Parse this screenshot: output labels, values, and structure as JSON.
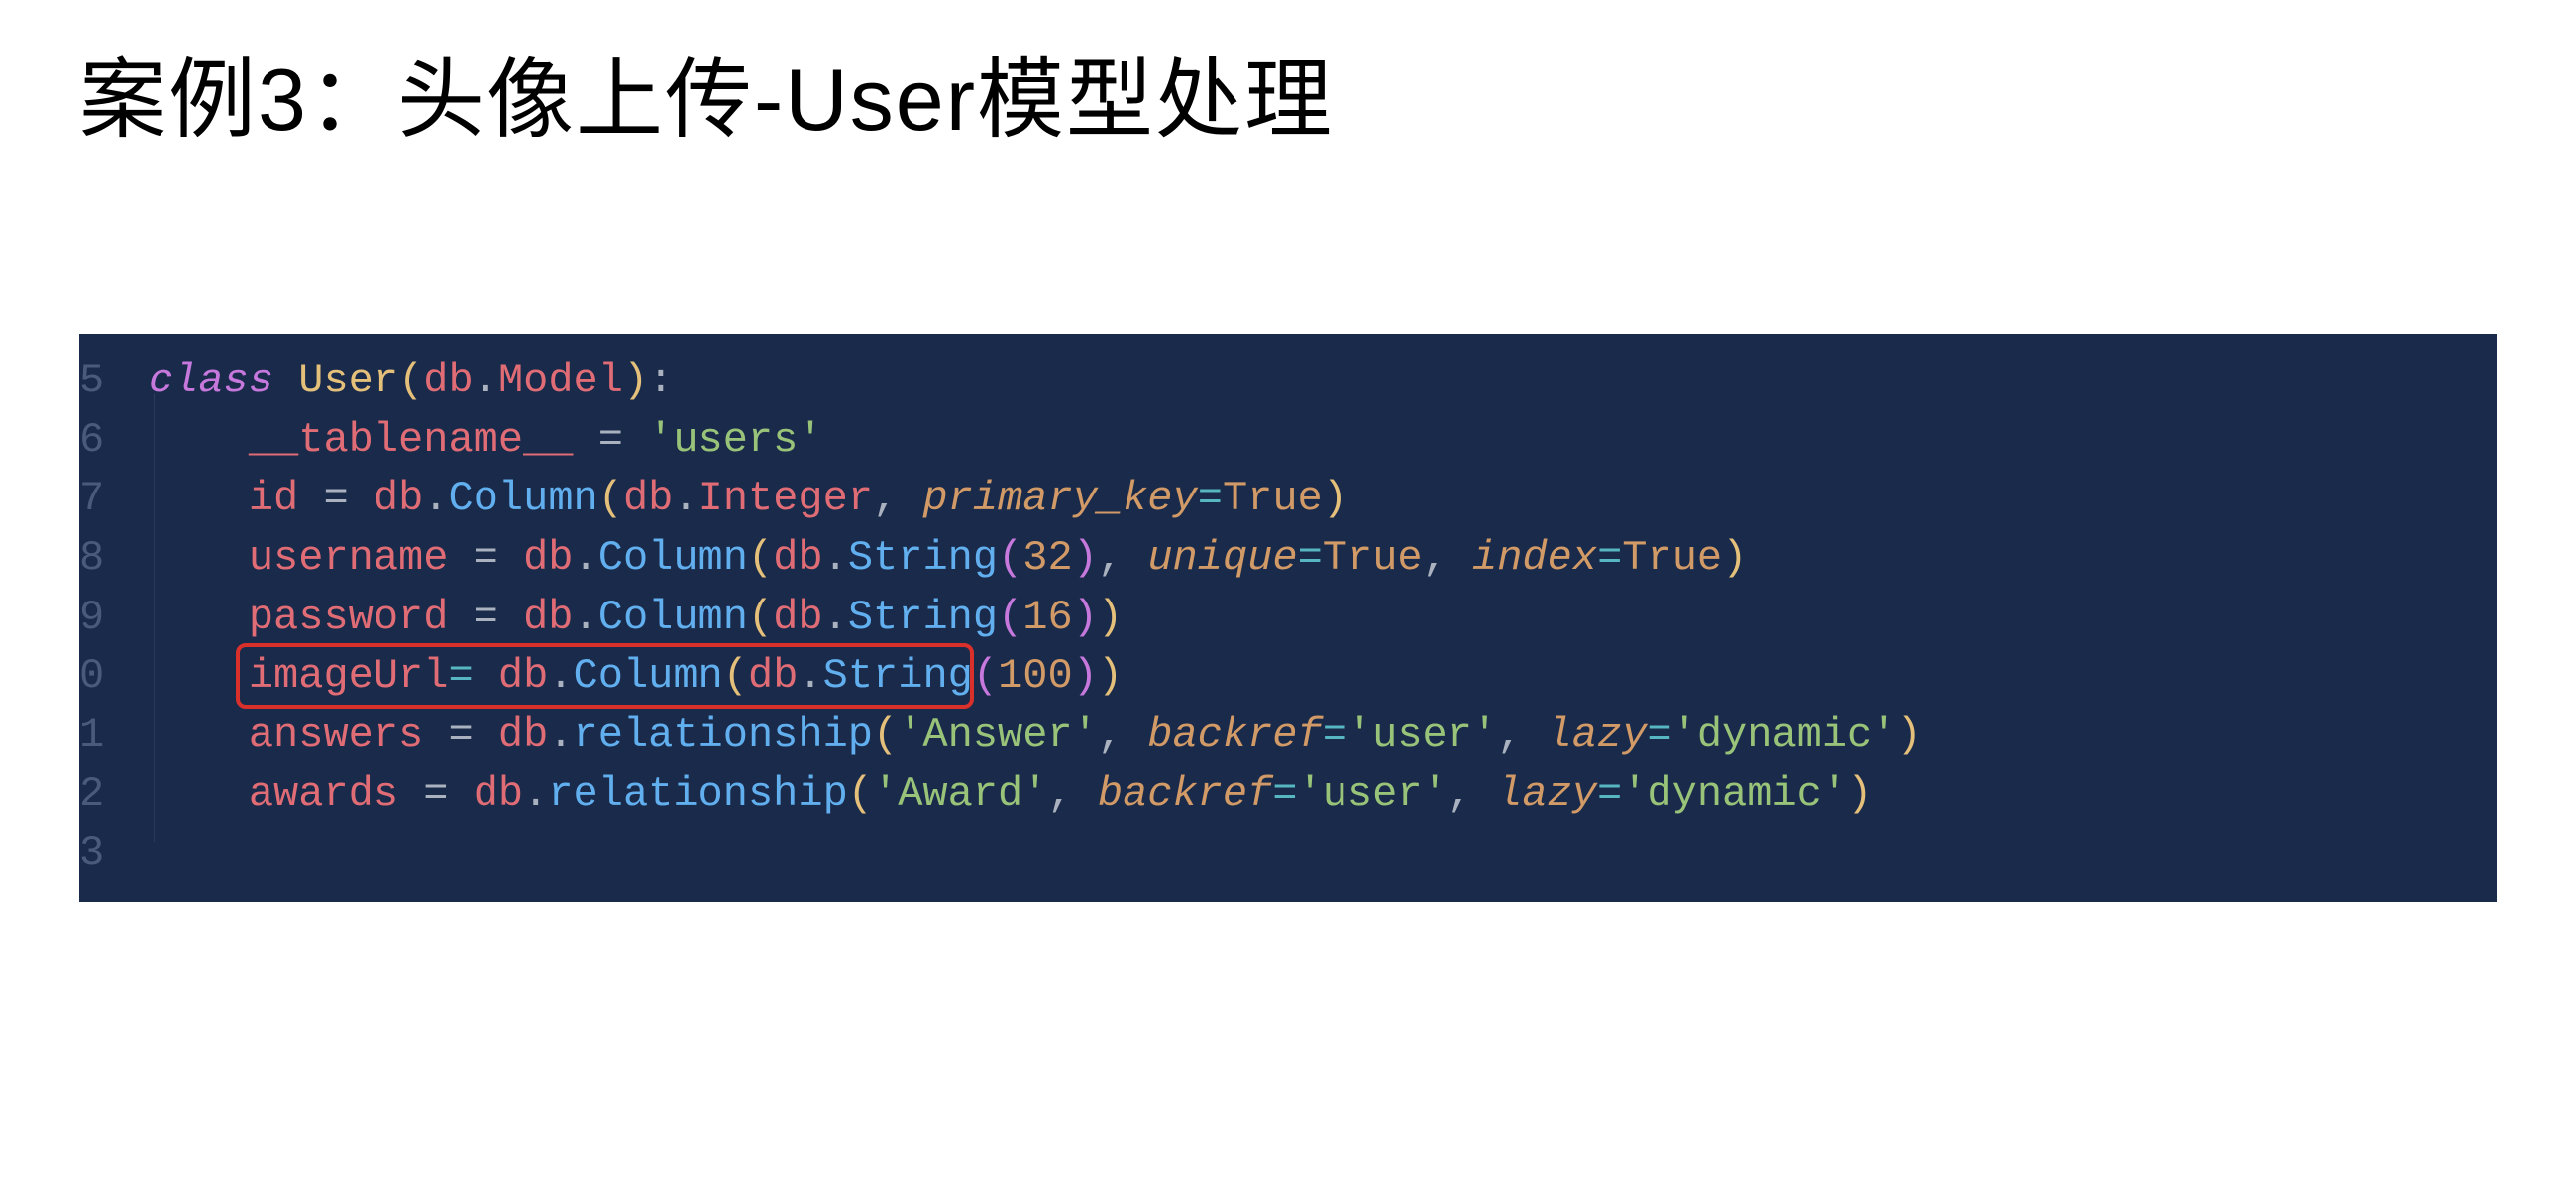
{
  "title": "案例3：头像上传-User模型处理",
  "code": {
    "line_numbers": [
      "5",
      "6",
      "7",
      "8",
      "9",
      "0",
      "1",
      "2",
      "3"
    ],
    "lines": {
      "l1": {
        "kw": "class",
        "cls": "User",
        "paren_open": "(",
        "db": "db",
        "dot": ".",
        "model": "Model",
        "paren_close": ")",
        "colon": ":"
      },
      "l2": {
        "attr": "__tablename__",
        "eq": " = ",
        "str": "'users'"
      },
      "l3": {
        "attr": "id",
        "eq": " = ",
        "db1": "db",
        "dot1": ".",
        "col": "Column",
        "po": "(",
        "db2": "db",
        "dot2": ".",
        "int": "Integer",
        "comma": ", ",
        "pk": "primary_key",
        "eq2": "=",
        "true": "True",
        "pc": ")"
      },
      "l4": {
        "attr": "username",
        "eq": " = ",
        "db1": "db",
        "dot1": ".",
        "col": "Column",
        "po": "(",
        "db2": "db",
        "dot2": ".",
        "str_t": "String",
        "po2": "(",
        "num": "32",
        "pc2": ")",
        "comma": ", ",
        "unique": "unique",
        "eq2": "=",
        "true1": "True",
        "comma2": ", ",
        "index": "index",
        "eq3": "=",
        "true2": "True",
        "pc": ")"
      },
      "l5": {
        "attr": "password",
        "eq": " = ",
        "db1": "db",
        "dot1": ".",
        "col": "Column",
        "po": "(",
        "db2": "db",
        "dot2": ".",
        "str_t": "String",
        "po2": "(",
        "num": "16",
        "pc2": ")",
        "pc": ")"
      },
      "l6": {
        "attr": "imageUrl",
        "eq": "= ",
        "db1": "db",
        "dot1": ".",
        "col": "Column",
        "po": "(",
        "db2": "db",
        "dot2": ".",
        "str_t": "String",
        "po2": "(",
        "num": "100",
        "pc2": ")",
        "pc": ")"
      },
      "l7": {
        "attr": "answers",
        "eq": " = ",
        "db1": "db",
        "dot1": ".",
        "rel": "relationship",
        "po": "(",
        "str1": "'Answer'",
        "comma": ", ",
        "backref": "backref",
        "eq2": "=",
        "str2": "'user'",
        "comma2": ", ",
        "lazy": "lazy",
        "eq3": "=",
        "str3": "'dynamic'",
        "pc": ")"
      },
      "l8": {
        "attr": "awards",
        "eq": " = ",
        "db1": "db",
        "dot1": ".",
        "rel": "relationship",
        "po": "(",
        "str1": "'Award'",
        "comma": ", ",
        "backref": "backref",
        "eq2": "=",
        "str2": "'user'",
        "comma2": ", ",
        "lazy": "lazy",
        "eq3": "=",
        "str3": "'dynamic'",
        "pc": ")"
      }
    }
  }
}
